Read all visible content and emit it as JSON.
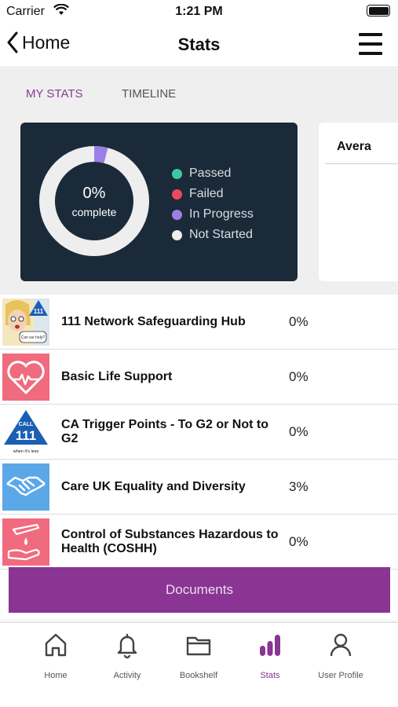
{
  "status_bar": {
    "carrier": "Carrier",
    "time": "1:21 PM"
  },
  "nav": {
    "back_label": "Home",
    "title": "Stats"
  },
  "stats_tabs": {
    "my_stats": "MY STATS",
    "timeline": "TIMELINE"
  },
  "summary": {
    "percent": "0%",
    "percent_label": "complete",
    "in_progress_fraction": 0.04,
    "legend": [
      {
        "label": "Passed",
        "color": "#3ec8a0"
      },
      {
        "label": "Failed",
        "color": "#f04760"
      },
      {
        "label": "In Progress",
        "color": "#9b7fe6"
      },
      {
        "label": "Not Started",
        "color": "#eeeeee"
      }
    ]
  },
  "average_card": {
    "title": "Avera"
  },
  "courses": [
    {
      "title": "111 Network Safeguarding Hub",
      "percent": "0%",
      "icon": "comic-111-icon"
    },
    {
      "title": "Basic Life Support",
      "percent": "0%",
      "icon": "heart-pulse-icon"
    },
    {
      "title": "CA Trigger Points - To G2 or Not to G2",
      "percent": "0%",
      "icon": "nhs-111-icon"
    },
    {
      "title": "Care UK Equality and Diversity",
      "percent": "3%",
      "icon": "handshake-icon"
    },
    {
      "title": "Control of Substances Hazardous to Health (COSHH)",
      "percent": "0%",
      "icon": "hazard-hand-icon"
    }
  ],
  "thumb_text": {
    "call": "CALL",
    "num": "111",
    "sub": "when it's less",
    "bubble": "Can we help?"
  },
  "documents_label": "Documents",
  "tabbar": [
    {
      "label": "Home",
      "icon": "home-icon"
    },
    {
      "label": "Activity",
      "icon": "bell-icon"
    },
    {
      "label": "Bookshelf",
      "icon": "folder-icon"
    },
    {
      "label": "Stats",
      "icon": "bar-chart-icon",
      "active": true
    },
    {
      "label": "User Profile",
      "icon": "user-icon"
    }
  ],
  "colors": {
    "accent": "#8a3493",
    "dark_card": "#1b2a38",
    "thumb_pink": "#f06b7e",
    "thumb_blue": "#5aa8e8",
    "nhs_blue": "#1a5fb4"
  }
}
